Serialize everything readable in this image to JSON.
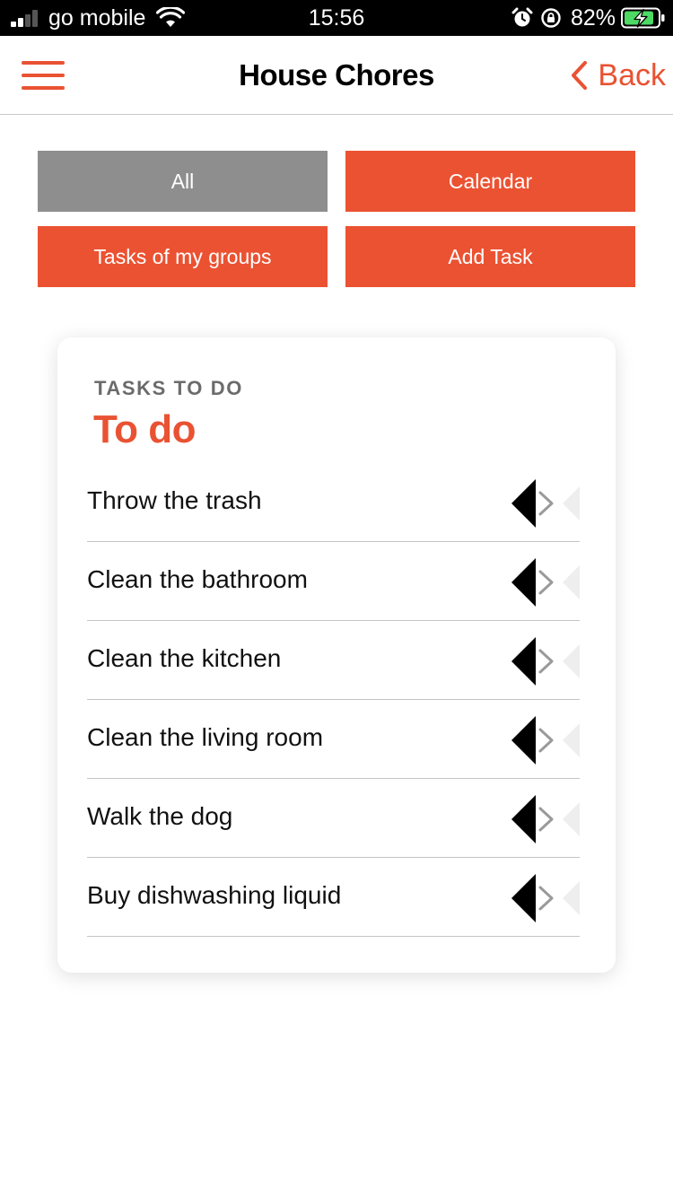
{
  "status_bar": {
    "carrier": "go mobile",
    "time": "15:56",
    "battery_percent": "82%",
    "icons": [
      "signal-icon",
      "wifi-icon",
      "alarm-icon",
      "rotation-lock-icon",
      "battery-charging-icon"
    ]
  },
  "navbar": {
    "title": "House Chores",
    "back_label": "Back",
    "menu_icon": "hamburger-menu-icon",
    "back_icon": "chevron-left-icon"
  },
  "buttons": {
    "all": "All",
    "calendar": "Calendar",
    "my_groups": "Tasks of my groups",
    "add_task": "Add Task"
  },
  "card": {
    "caption": "TASKS TO DO",
    "title": "To do",
    "tasks": [
      {
        "label": "Throw the trash"
      },
      {
        "label": "Clean the bathroom"
      },
      {
        "label": "Clean the kitchen"
      },
      {
        "label": "Clean the living room"
      },
      {
        "label": "Walk the dog"
      },
      {
        "label": "Buy dishwashing liquid"
      }
    ],
    "row_icon": "disclosure-arrow-icon"
  },
  "colors": {
    "accent": "#eb5232",
    "button_inactive": "#8e8e8e",
    "status_bar_bg": "#000000",
    "battery_fill": "#4cd964",
    "caption_text": "#6b6b6b"
  }
}
